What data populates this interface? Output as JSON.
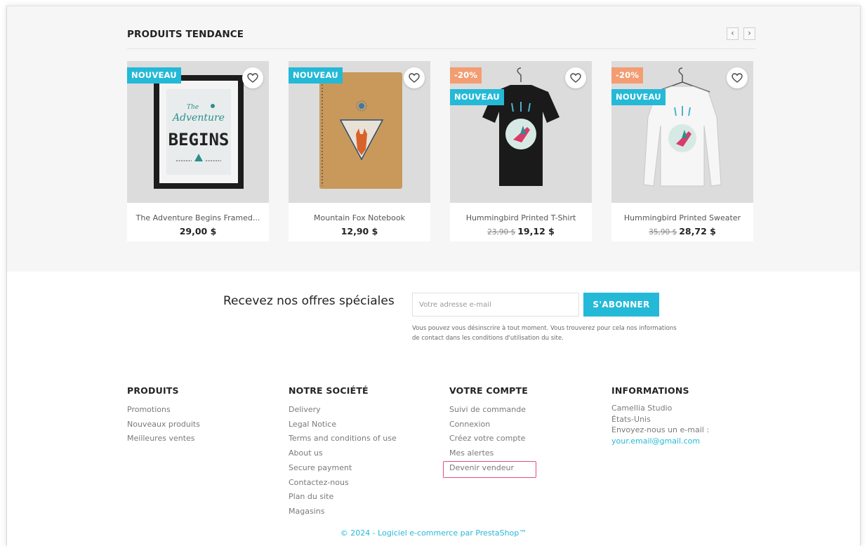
{
  "trending": {
    "title": "PRODUITS TENDANCE",
    "prev_label": "‹",
    "next_label": "›",
    "products": [
      {
        "name": "The Adventure Begins Framed...",
        "price": "29,00 $",
        "old_price": "",
        "flags": [
          "NOUVEAU"
        ],
        "poster_lines": [
          "The",
          "Adventure",
          "BEGINS"
        ]
      },
      {
        "name": "Mountain Fox Notebook",
        "price": "12,90 $",
        "old_price": "",
        "flags": [
          "NOUVEAU"
        ]
      },
      {
        "name": "Hummingbird Printed T-Shirt",
        "price": "19,12 $",
        "old_price": "23,90 $",
        "flags": [
          "-20%",
          "NOUVEAU"
        ]
      },
      {
        "name": "Hummingbird Printed Sweater",
        "price": "28,72 $",
        "old_price": "35,90 $",
        "flags": [
          "-20%",
          "NOUVEAU"
        ]
      }
    ]
  },
  "newsletter": {
    "label": "Recevez nos offres spéciales",
    "placeholder": "Votre adresse e-mail",
    "button": "S'ABONNER",
    "note": "Vous pouvez vous désinscrire à tout moment. Vous trouverez pour cela nos informations de contact dans les conditions d'utilisation du site."
  },
  "footer": {
    "products": {
      "heading": "PRODUITS",
      "links": [
        "Promotions",
        "Nouveaux produits",
        "Meilleures ventes"
      ]
    },
    "company": {
      "heading": "NOTRE SOCIÉTÉ",
      "links": [
        "Delivery",
        "Legal Notice",
        "Terms and conditions of use",
        "About us",
        "Secure payment",
        "Contactez-nous",
        "Plan du site",
        "Magasins"
      ]
    },
    "account": {
      "heading": "VOTRE COMPTE",
      "links": [
        "Suivi de commande",
        "Connexion",
        "Créez votre compte",
        "Mes alertes",
        "Devenir vendeur"
      ]
    },
    "info": {
      "heading": "INFORMATIONS",
      "lines": [
        "Camellia Studio",
        "États-Unis",
        "Envoyez-nous un e-mail :"
      ],
      "email": "your.email@gmail.com"
    }
  },
  "copyright": "© 2024 - Logiciel e-commerce par PrestaShop™",
  "colors": {
    "accent": "#24b9d7",
    "discount": "#f39d72",
    "highlight": "#e0507a"
  }
}
